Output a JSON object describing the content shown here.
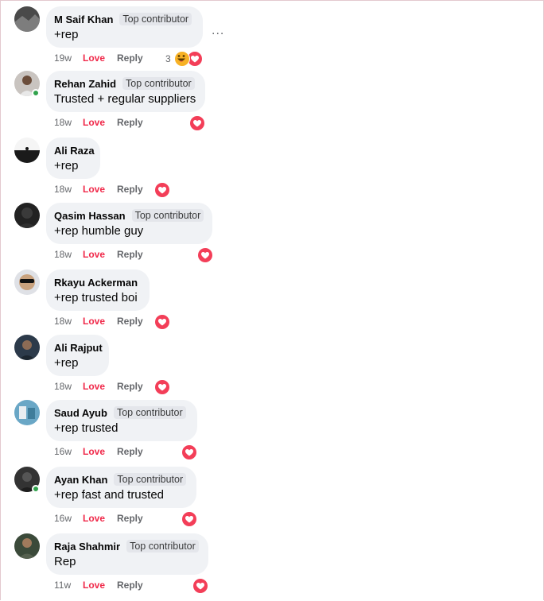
{
  "comments": [
    {
      "name": "M Saif Khan",
      "badge": "Top contributor",
      "text": "+rep",
      "time": "19w",
      "love": "Love",
      "reply": "Reply",
      "reaction_count": "3",
      "reactions": [
        "haha-icon",
        "heart-icon"
      ],
      "online": false,
      "avatar_color": "#4a4a4a"
    },
    {
      "name": "Rehan Zahid",
      "badge": "Top contributor",
      "text": "Trusted + regular suppliers",
      "time": "18w",
      "love": "Love",
      "reply": "Reply",
      "reaction_count": "",
      "reactions": [
        "heart-icon"
      ],
      "online": true,
      "avatar_color": "#c9c4c0"
    },
    {
      "name": "Ali Raza",
      "badge": "",
      "text": "+rep",
      "time": "18w",
      "love": "Love",
      "reply": "Reply",
      "reaction_count": "",
      "reactions": [
        "heart-icon"
      ],
      "online": false,
      "avatar_color": "#1a1a1a"
    },
    {
      "name": "Qasim Hassan",
      "badge": "Top contributor",
      "text": "+rep humble guy",
      "time": "18w",
      "love": "Love",
      "reply": "Reply",
      "reaction_count": "",
      "reactions": [
        "heart-icon"
      ],
      "online": false,
      "avatar_color": "#222222"
    },
    {
      "name": "Rkayu Ackerman",
      "badge": "",
      "text": "+rep trusted boi",
      "time": "18w",
      "love": "Love",
      "reply": "Reply",
      "reaction_count": "",
      "reactions": [
        "heart-icon"
      ],
      "online": false,
      "avatar_color": "#8a8d96"
    },
    {
      "name": "Ali Rajput",
      "badge": "",
      "text": "+rep",
      "time": "18w",
      "love": "Love",
      "reply": "Reply",
      "reaction_count": "",
      "reactions": [
        "heart-icon"
      ],
      "online": false,
      "avatar_color": "#2c3a4a"
    },
    {
      "name": "Saud Ayub",
      "badge": "Top contributor",
      "text": "+rep trusted",
      "time": "16w",
      "love": "Love",
      "reply": "Reply",
      "reaction_count": "",
      "reactions": [
        "heart-icon"
      ],
      "online": false,
      "avatar_color": "#6aa7c6"
    },
    {
      "name": "Ayan Khan",
      "badge": "Top contributor",
      "text": "+rep fast and trusted",
      "time": "16w",
      "love": "Love",
      "reply": "Reply",
      "reaction_count": "",
      "reactions": [
        "heart-icon"
      ],
      "online": true,
      "avatar_color": "#333333"
    },
    {
      "name": "Raja Shahmir",
      "badge": "Top contributor",
      "text": "Rep",
      "time": "11w",
      "love": "Love",
      "reply": "Reply",
      "reaction_count": "",
      "reactions": [
        "heart-icon"
      ],
      "online": false,
      "avatar_color": "#3b4a3a"
    }
  ],
  "more_options_label": "..."
}
